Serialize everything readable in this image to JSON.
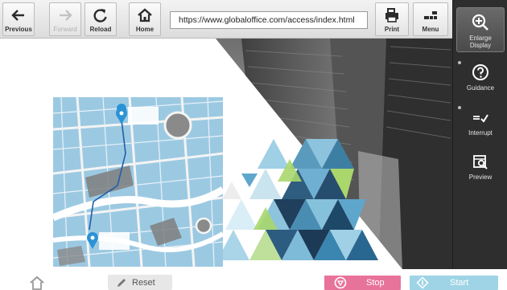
{
  "toolbar": {
    "previous_label": "Previous",
    "forward_label": "Forward",
    "reload_label": "Reload",
    "home_label": "Home",
    "url": "https://www.globaloffice.com/access/index.html",
    "print_label": "Print",
    "menu_label": "Menu"
  },
  "side_panel": {
    "enlarge_label_1": "Enlarge",
    "enlarge_label_2": "Display",
    "guidance_label": "Guidance",
    "interrupt_label": "Interrupt",
    "preview_label": "Preview"
  },
  "bottom_bar": {
    "reset_label": "Reset",
    "stop_label": "Stop",
    "start_label": "Start"
  },
  "colors": {
    "stop": "#e8739a",
    "start": "#9fd4e6",
    "panel": "#2e2e2e",
    "map_water": "#8fc3df"
  },
  "icons": [
    "arrow-left-icon",
    "arrow-right-icon",
    "reload-icon",
    "home-icon",
    "printer-icon",
    "menu-icon",
    "zoom-in-icon",
    "question-icon",
    "interrupt-icon",
    "preview-icon",
    "pencil-icon",
    "stop-icon",
    "start-icon",
    "map-pin-icon"
  ]
}
